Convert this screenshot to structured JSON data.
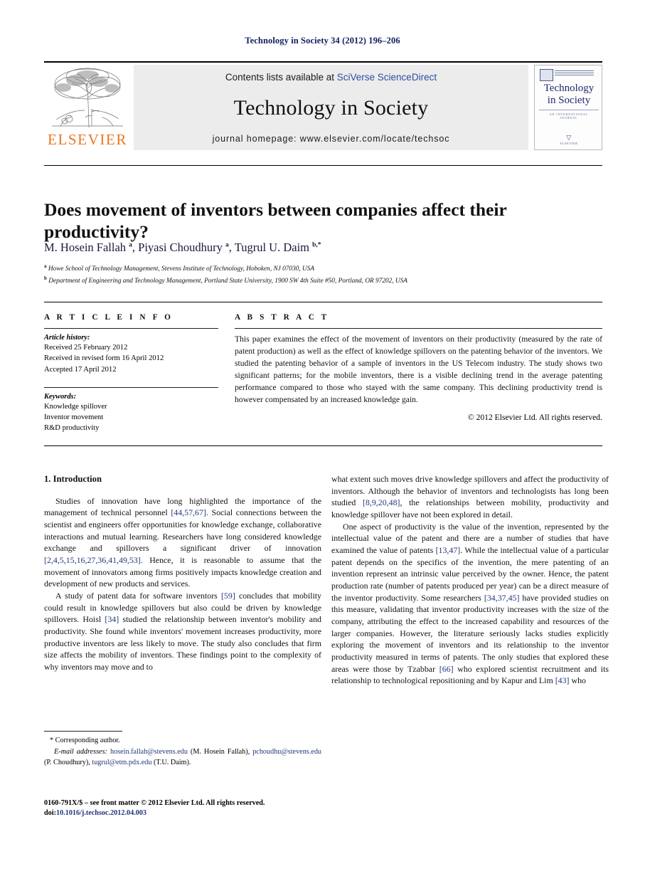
{
  "running_head": "Technology in Society 34 (2012) 196–206",
  "masthead": {
    "publisher_name": "ELSEVIER",
    "contents_prefix": "Contents lists available at ",
    "contents_link": "SciVerse ScienceDirect",
    "journal_title": "Technology in Society",
    "homepage": "journal homepage: www.elsevier.com/locate/techsoc",
    "cover": {
      "title_line1": "Technology",
      "title_line2": "in Society",
      "subtitle": "AN INTERNATIONAL JOURNAL",
      "footer": "ELSEVIER"
    }
  },
  "article": {
    "title": "Does movement of inventors between companies affect their productivity?",
    "authors": "M. Hosein Fallah a, Piyasi Choudhury a, Tugrul U. Daim b,*",
    "affiliation_a": "Howe School of Technology Management, Stevens Institute of Technology, Hoboken, NJ 07030, USA",
    "affiliation_b": "Department of Engineering and Technology Management, Portland State University, 1900 SW 4th Suite #50, Portland, OR 97202, USA"
  },
  "info": {
    "heading": "A R T I C L E   I N F O",
    "history_label": "Article history:",
    "received": "Received 25 February 2012",
    "revised": "Received in revised form 16 April 2012",
    "accepted": "Accepted 17 April 2012",
    "keywords_label": "Keywords:",
    "keyword_1": "Knowledge spillover",
    "keyword_2": "Inventor movement",
    "keyword_3": "R&D productivity"
  },
  "abstract": {
    "heading": "A B S T R A C T",
    "text": "This paper examines the effect of the movement of inventors on their productivity (measured by the rate of patent production) as well as the effect of knowledge spillovers on the patenting behavior of the inventors. We studied the patenting behavior of a sample of inventors in the US Telecom industry. The study shows two significant patterns; for the mobile inventors, there is a visible declining trend in the average patenting performance compared to those who stayed with the same company. This declining productivity trend is however compensated by an increased knowledge gain.",
    "copyright": "© 2012 Elsevier Ltd. All rights reserved."
  },
  "body": {
    "section_heading": "1. Introduction",
    "left_p1_a": "Studies of innovation have long highlighted the importance of the management of technical personnel ",
    "left_p1_cite1": "[44,57,67]",
    "left_p1_b": ". Social connections between the scientist and engineers offer opportunities for knowledge exchange, collaborative interactions and mutual learning. Researchers have long considered knowledge exchange and spillovers a significant driver of innovation ",
    "left_p1_cite2": "[2,4,5,15,16,27,36,41,49,53]",
    "left_p1_c": ". Hence, it is reasonable to assume that the movement of innovators among firms positively impacts knowledge creation and development of new products and services.",
    "left_p2_a": "A study of patent data for software inventors ",
    "left_p2_cite1": "[59]",
    "left_p2_b": " concludes that mobility could result in knowledge spillovers but also could be driven by knowledge spillovers. Hoisl ",
    "left_p2_cite2": "[34]",
    "left_p2_c": " studied the relationship between inventor's mobility and productivity. She found while inventors' movement increases productivity, more productive inventors are less likely to move. The study also concludes that firm size affects the mobility of inventors. These findings point to the complexity of why inventors may move and to",
    "right_p1_a": "what extent such moves drive knowledge spillovers and affect the productivity of inventors. Although the behavior of inventors and technologists has long been studied ",
    "right_p1_cite1": "[8,9,20,48]",
    "right_p1_b": ", the relationships between mobility, productivity and knowledge spillover have not been explored in detail.",
    "right_p2_a": "One aspect of productivity is the value of the invention, represented by the intellectual value of the patent and there are a number of studies that have examined the value of patents ",
    "right_p2_cite1": "[13,47]",
    "right_p2_b": ". While the intellectual value of a particular patent depends on the specifics of the invention, the mere patenting of an invention represent an intrinsic value perceived by the owner. Hence, the patent production rate (number of patents produced per year) can be a direct measure of the inventor productivity. Some researchers ",
    "right_p2_cite2": "[34,37,45]",
    "right_p2_c": " have provided studies on this measure, validating that inventor productivity increases with the size of the company, attributing the effect to the increased capability and resources of the larger companies. However, the literature seriously lacks studies explicitly exploring the movement of inventors and its relationship to the inventor productivity measured in terms of patents. The only studies that explored these areas were those by Tzabbar ",
    "right_p2_cite3": "[66]",
    "right_p2_d": " who explored scientist recruitment and its relationship to technological repositioning and by Kapur and Lim ",
    "right_p2_cite4": "[43]",
    "right_p2_e": " who"
  },
  "footnotes": {
    "corresponding": "* Corresponding author.",
    "email_label": "E-mail addresses:",
    "email_1": "hosein.fallah@stevens.edu",
    "email_1_name": " (M. Hosein Fallah), ",
    "email_2": "pchoudhu@stevens.edu",
    "email_2_name": " (P. Choudhury), ",
    "email_3": "tugrul@etm.pdx.edu",
    "email_3_name": " (T.U. Daim)."
  },
  "imprint": {
    "line1": "0160-791X/$ – see front matter © 2012 Elsevier Ltd. All rights reserved.",
    "doi_label": "doi:",
    "doi_value": "10.1016/j.techsoc.2012.04.003"
  },
  "colors": {
    "link_blue": "#23357e",
    "header_blue": "#11205c",
    "elsevier_orange": "#e87722",
    "band_gray": "#ececec"
  }
}
